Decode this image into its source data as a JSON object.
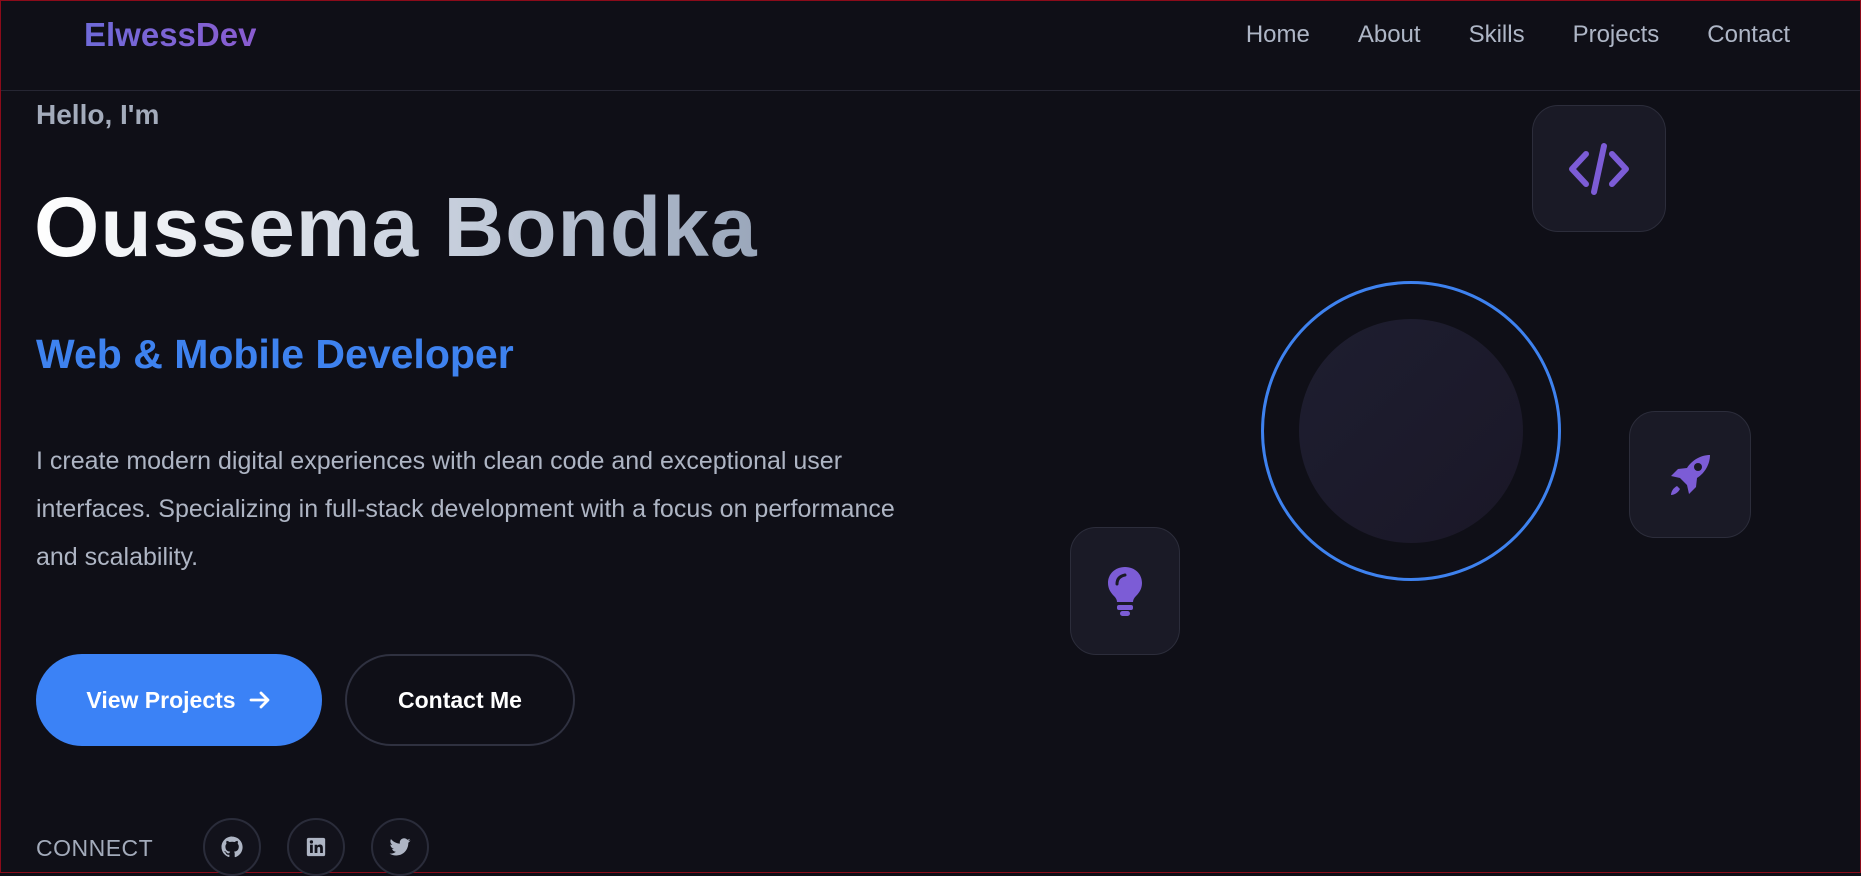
{
  "nav": {
    "logo": "ElwessDev",
    "links": [
      "Home",
      "About",
      "Skills",
      "Projects",
      "Contact"
    ]
  },
  "hero": {
    "greeting": "Hello, I'm",
    "name": "Oussema Bondka",
    "role": "Web & Mobile Developer",
    "description": "I create modern digital experiences with clean code and exceptional user interfaces. Specializing in full-stack development with a focus on performance and scalability.",
    "primary_button": "View Projects",
    "secondary_button": "Contact Me",
    "connect_label": "CONNECT"
  },
  "social_icons": [
    "github-icon",
    "linkedin-icon",
    "twitter-icon"
  ],
  "decor_icons": [
    "code-icon",
    "rocket-icon",
    "lightbulb-icon"
  ],
  "colors": {
    "background": "#0f0f17",
    "accent_blue": "#3b82f6",
    "accent_purple": "#7c5cd6",
    "text_muted": "#aeb5c4"
  }
}
